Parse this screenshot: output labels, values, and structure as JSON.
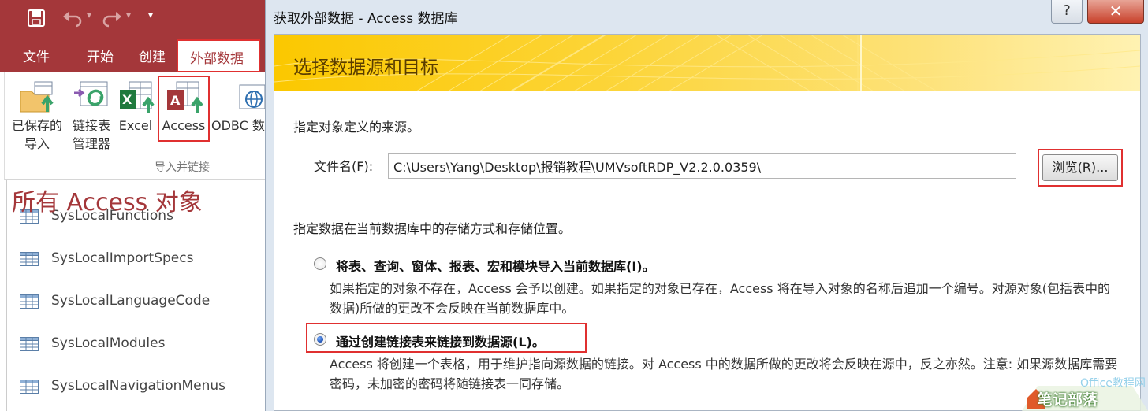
{
  "access": {
    "tabs": {
      "file": "文件",
      "home": "开始",
      "create": "创建",
      "external": "外部数据"
    },
    "ribbon": {
      "saved_import": "已保存的\n导入",
      "linked_table_manager": "链接表\n管理器",
      "excel": "Excel",
      "access": "Access",
      "odbc": "ODBC 数",
      "group_label": "导入并链接"
    },
    "nav": {
      "header": "所有 Access 对象",
      "items": [
        "SysLocalFunctions",
        "SysLocalImportSpecs",
        "SysLocalLanguageCode",
        "SysLocalModules",
        "SysLocalNavigationMenus"
      ]
    },
    "colors": {
      "accent": "#a4373a",
      "highlight": "#e03030"
    }
  },
  "dialog": {
    "title": "获取外部数据 - Access 数据库",
    "help": "?",
    "close": "✕",
    "banner_title": "选择数据源和目标",
    "source_instruction": "指定对象定义的来源。",
    "file_label": "文件名(F):",
    "file_value": "C:\\Users\\Yang\\Desktop\\报销教程\\UMVsoftRDP_V2.2.0.0359\\",
    "browse": "浏览(R)...",
    "storage_instruction": "指定数据在当前数据库中的存储方式和存储位置。",
    "options": [
      {
        "label": "将表、查询、窗体、报表、宏和模块导入当前数据库(I)。",
        "description": "如果指定的对象不存在，Access 会予以创建。如果指定的对象已存在，Access 将在导入对象的名称后追加一个编号。对源对象(包括表中的数据)所做的更改不会反映在当前数据库中。",
        "checked": false
      },
      {
        "label": "通过创建链接表来链接到数据源(L)。",
        "description": "Access 将创建一个表格，用于维护指向源数据的链接。对 Access 中的数据所做的更改将会反映在源中，反之亦然。注意: 如果源数据库需要密码，未加密的密码将随链接表一同存储。",
        "checked": true
      }
    ]
  },
  "watermark": {
    "text": "笔记部落",
    "site": "Office教程网"
  }
}
